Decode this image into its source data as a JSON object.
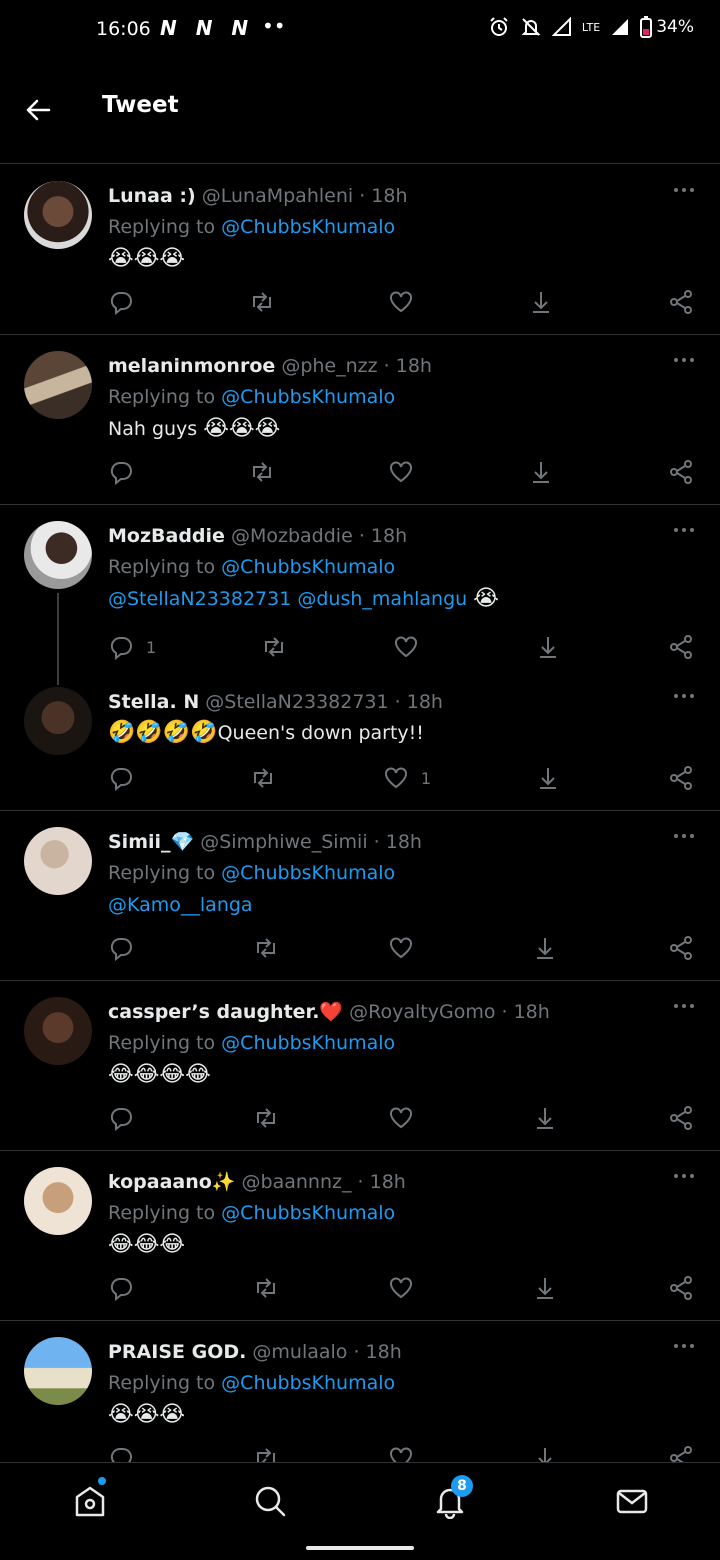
{
  "status_bar": {
    "time": "16:06",
    "notif_icons": "N N N",
    "more_dots": "••",
    "network": "LTE",
    "battery": "34%"
  },
  "header": {
    "title": "Tweet"
  },
  "replying_label": "Replying to",
  "tweets": [
    {
      "name": "Lunaa :)",
      "handle": "@LunaMpahleni",
      "time": "18h",
      "replying_to": "@ChubbsKhumalo",
      "text": "😭😭😭",
      "reply_count": "",
      "like_count": ""
    },
    {
      "name": "melaninmonroe",
      "handle": "@phe_nzz",
      "time": "18h",
      "replying_to": "@ChubbsKhumalo",
      "text_plain": "Nah guys",
      "text_emoji": "😭😭😭",
      "reply_count": "",
      "like_count": ""
    },
    {
      "name": "MozBaddie",
      "handle": "@Mozbaddie",
      "time": "18h",
      "replying_to": "@ChubbsKhumalo",
      "mention1": "@StellaN23382731",
      "mention2": "@dush_mahlangu",
      "text_emoji": "😭",
      "reply_count": "1",
      "like_count": ""
    },
    {
      "name": "Stella. N",
      "handle": "@StellaN23382731",
      "time": "18h",
      "text_emoji": "🤣🤣🤣🤣",
      "text_plain": "Queen's down party!!",
      "reply_count": "",
      "like_count": "1"
    },
    {
      "name": "Simii_",
      "name_emoji": "💎",
      "handle": "@Simphiwe_Simii",
      "time": "18h",
      "replying_to": "@ChubbsKhumalo",
      "mention1": "@Kamo__langa",
      "reply_count": "",
      "like_count": ""
    },
    {
      "name": "cassper’s daughter.",
      "name_emoji": "❤️",
      "handle": "@RoyaltyGomo",
      "time": "18h",
      "replying_to": "@ChubbsKhumalo",
      "text": "😂😂😂😂",
      "reply_count": "",
      "like_count": ""
    },
    {
      "name": "kopaaano",
      "name_emoji": "✨",
      "handle": "@baannnz_",
      "time": "18h",
      "replying_to": "@ChubbsKhumalo",
      "text": "😂😂😂",
      "reply_count": "",
      "like_count": ""
    },
    {
      "name": "PRAISE GOD.",
      "handle": "@mulaalo",
      "time": "18h",
      "replying_to": "@ChubbsKhumalo",
      "text": "😭😭😭",
      "reply_count": "",
      "like_count": ""
    }
  ],
  "bottom_nav": {
    "notifications_badge": "8"
  },
  "colors": {
    "accent": "#1d9bf0",
    "muted": "#71767b",
    "background": "#000000",
    "divider": "#2f3336"
  },
  "icons": [
    "back-arrow-icon",
    "more-icon",
    "reply-icon",
    "retweet-icon",
    "like-icon",
    "download-icon",
    "share-icon",
    "home-icon",
    "search-icon",
    "bell-icon",
    "mail-icon"
  ]
}
